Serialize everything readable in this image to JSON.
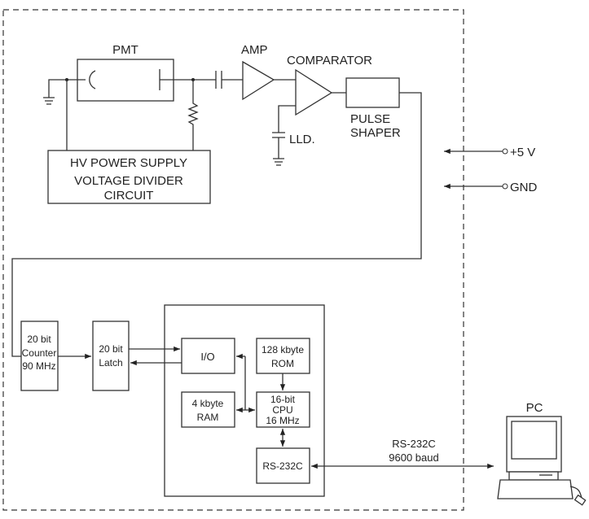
{
  "labels": {
    "pmt": "PMT",
    "amp": "AMP",
    "comparator": "COMPARATOR",
    "lld": "LLD.",
    "pulse_shaper": [
      "PULSE",
      "SHAPER"
    ],
    "hv_supply": [
      "HV POWER SUPPLY",
      "VOLTAGE DIVIDER",
      "CIRCUIT"
    ],
    "plus5v": "+5 V",
    "gnd": "GND",
    "counter": [
      "20 bit",
      "Counter",
      "90 MHz"
    ],
    "latch": [
      "20 bit",
      "Latch"
    ],
    "io": "I/O",
    "rom": [
      "128 kbyte",
      "ROM"
    ],
    "ram": [
      "4 kbyte",
      "RAM"
    ],
    "cpu": [
      "16-bit",
      "CPU",
      "16 MHz"
    ],
    "rs232_box": "RS-232C",
    "link": [
      "RS-232C",
      "9600 baud"
    ],
    "pc": "PC"
  },
  "colors": {
    "line": "#333333",
    "background": "#ffffff"
  }
}
